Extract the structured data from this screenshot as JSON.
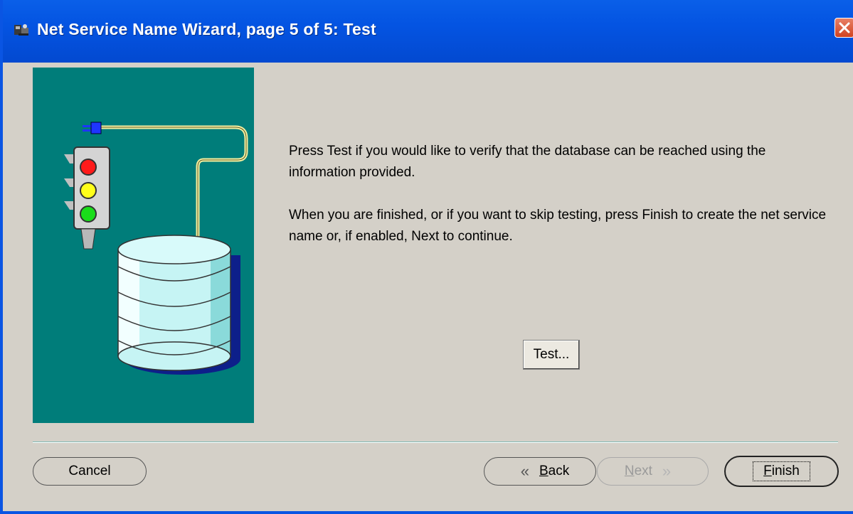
{
  "window": {
    "title": "Net Service Name Wizard, page 5 of 5: Test"
  },
  "body": {
    "paragraph1": "Press Test if you would like to verify that the database can be reached using the information provided.",
    "paragraph2": "When you are finished, or if you want to skip testing, press Finish to create the net service name or, if enabled, Next to continue."
  },
  "buttons": {
    "test": "Test...",
    "cancel": "Cancel",
    "back_rest": "ack",
    "back_mnemonic": "B",
    "next_rest": "ext",
    "next_mnemonic": "N",
    "finish_rest": "inish",
    "finish_mnemonic": "F",
    "next_enabled": false
  },
  "colors": {
    "title_bar": "#0454e2",
    "graphic_bg": "#007d7a",
    "dialog_bg": "#d4d0c8"
  }
}
